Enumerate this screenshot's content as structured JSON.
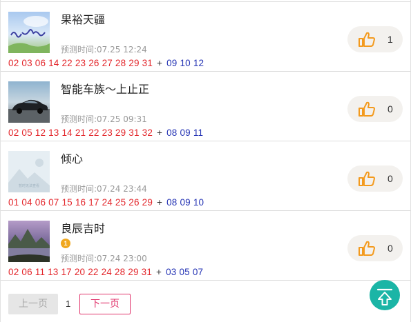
{
  "items": [
    {
      "name": "果裕天疆",
      "time": "预测时间:07.25 12:24",
      "red": [
        "02",
        "03",
        "06",
        "14",
        "22",
        "23",
        "26",
        "27",
        "28",
        "29",
        "31"
      ],
      "plus": "+",
      "blue": [
        "09",
        "10",
        "12"
      ],
      "likes": "1",
      "avatar_icon": "calligraphy-avatar-icon"
    },
    {
      "name": "智能车族～上止正",
      "time": "预测时间:07.25 09:31",
      "red": [
        "02",
        "05",
        "12",
        "13",
        "14",
        "21",
        "22",
        "23",
        "29",
        "31",
        "32"
      ],
      "plus": "+",
      "blue": [
        "08",
        "09",
        "11"
      ],
      "likes": "0",
      "avatar_icon": "car-avatar-icon"
    },
    {
      "name": "倾心",
      "time": "预测时间:07.24 23:44",
      "red": [
        "01",
        "04",
        "06",
        "07",
        "15",
        "16",
        "17",
        "24",
        "25",
        "26",
        "29"
      ],
      "plus": "+",
      "blue": [
        "08",
        "09",
        "10"
      ],
      "likes": "0",
      "avatar_icon": "placeholder-avatar-icon",
      "avatar_caption": "暂时无法查看"
    },
    {
      "name": "良辰吉时",
      "time": "预测时间:07.24 23:00",
      "red": [
        "02",
        "06",
        "11",
        "13",
        "17",
        "20",
        "22",
        "24",
        "28",
        "29",
        "31"
      ],
      "plus": "+",
      "blue": [
        "03",
        "05",
        "07"
      ],
      "likes": "0",
      "avatar_icon": "landscape-avatar-icon",
      "badge": "1"
    }
  ],
  "pager": {
    "prev_label": "上一页",
    "page": "1",
    "next_label": "下一页"
  },
  "back_to_top_icon": "arrow-up-icon",
  "colors": {
    "red_ball": "#e3262b",
    "blue_ball": "#2433b4",
    "like_icon": "#f39a1e",
    "next_button": "#e0336b",
    "back_to_top": "#1bb5a6"
  }
}
